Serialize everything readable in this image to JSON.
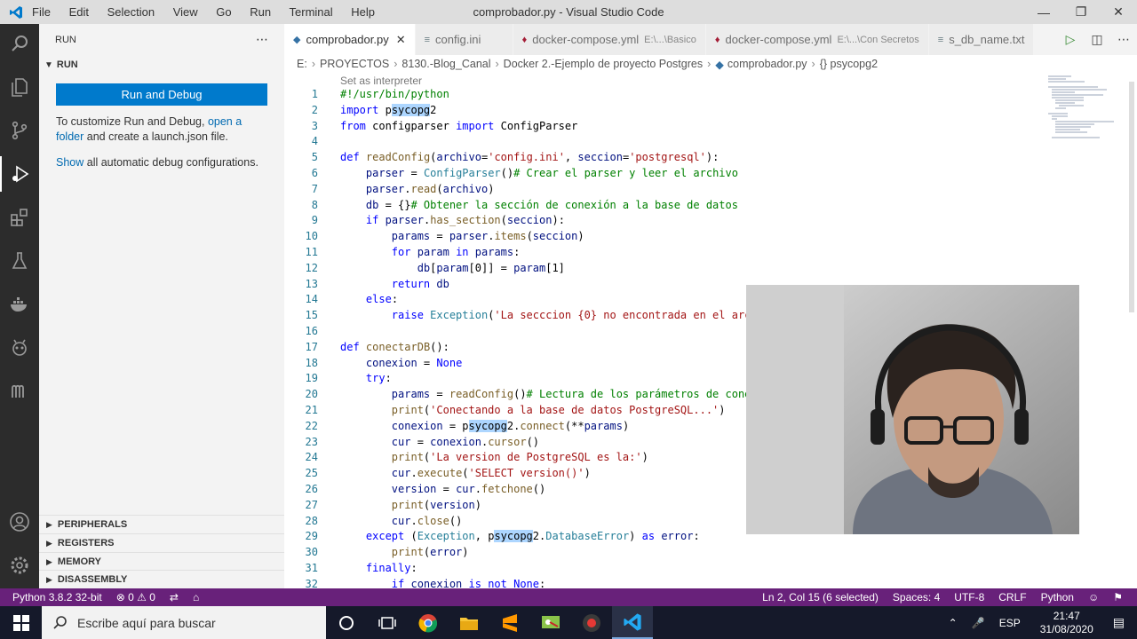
{
  "window": {
    "title": "comprobador.py - Visual Studio Code",
    "menu": [
      "File",
      "Edit",
      "Selection",
      "View",
      "Go",
      "Run",
      "Terminal",
      "Help"
    ]
  },
  "sidebar": {
    "header": "RUN",
    "section_title": "RUN",
    "run_button": "Run and Debug",
    "text1_a": "To customize Run and Debug, ",
    "text1_link": "open a folder",
    "text1_b": "and create a launch.json file.",
    "text2_link": "Show",
    "text2_b": " all automatic debug configurations.",
    "sections": [
      "PERIPHERALS",
      "REGISTERS",
      "MEMORY",
      "DISASSEMBLY"
    ]
  },
  "tabs": [
    {
      "label": "comprobador.py",
      "desc": "",
      "active": true
    },
    {
      "label": "config.ini",
      "desc": "",
      "active": false
    },
    {
      "label": "docker-compose.yml",
      "desc": "E:\\...\\Basico",
      "active": false
    },
    {
      "label": "docker-compose.yml",
      "desc": "E:\\...\\Con Secretos",
      "active": false
    },
    {
      "label": "s_db_name.txt",
      "desc": "",
      "active": false
    }
  ],
  "breadcrumb": [
    "E:",
    "PROYECTOS",
    "8130.-Blog_Canal",
    "Docker 2.-Ejemplo de proyecto Postgres",
    "comprobador.py",
    "{} psycopg2"
  ],
  "editor": {
    "codelens": "Set as interpreter"
  },
  "statusbar": {
    "interpreter": "Python 3.8.2 32-bit",
    "problems": "⊗ 0 ⚠ 0",
    "position": "Ln 2, Col 15 (6 selected)",
    "spaces": "Spaces: 4",
    "encoding": "UTF-8",
    "eol": "CRLF",
    "language": "Python"
  },
  "taskbar": {
    "search_placeholder": "Escribe aquí para buscar",
    "lang": "ESP",
    "time": "21:47",
    "date": "31/08/2020"
  },
  "colors": {
    "accent": "#007acc",
    "statusbar": "#68217a",
    "activitybar": "#2c2c2c"
  }
}
